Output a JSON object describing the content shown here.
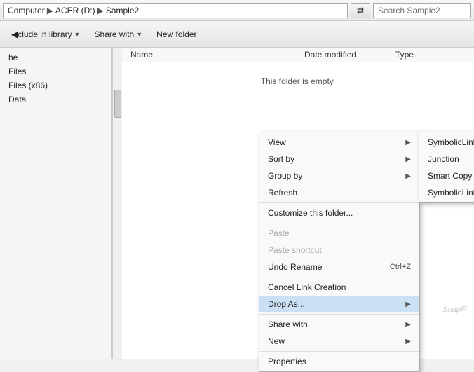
{
  "addressBar": {
    "path": [
      "Computer",
      "ACER (D:)",
      "Sample2"
    ],
    "navButtonLabel": "⇄",
    "searchPlaceholder": "Search Sample2"
  },
  "toolbar": {
    "buttons": [
      {
        "label": "clude in library",
        "arrow": "▼",
        "name": "include-in-library-btn"
      },
      {
        "label": "Share with",
        "arrow": "▼",
        "name": "share-with-btn"
      },
      {
        "label": "New folder",
        "name": "new-folder-btn"
      }
    ]
  },
  "sidebar": {
    "items": [
      {
        "label": "he",
        "name": "sidebar-item-he"
      },
      {
        "label": "Files",
        "name": "sidebar-item-files"
      },
      {
        "label": "Files (x86)",
        "name": "sidebar-item-files-x86"
      },
      {
        "label": "Data",
        "name": "sidebar-item-data"
      }
    ]
  },
  "columns": {
    "name": "Name",
    "dateModified": "Date modified",
    "type": "Type"
  },
  "emptyMessage": "This folder is empty.",
  "contextMenu": {
    "items": [
      {
        "label": "View",
        "hasArrow": true,
        "disabled": false,
        "name": "ctx-view"
      },
      {
        "label": "Sort by",
        "hasArrow": true,
        "disabled": false,
        "name": "ctx-sort-by"
      },
      {
        "label": "Group by",
        "hasArrow": true,
        "disabled": false,
        "name": "ctx-group-by"
      },
      {
        "label": "Refresh",
        "hasArrow": false,
        "disabled": false,
        "name": "ctx-refresh"
      },
      {
        "sep": true
      },
      {
        "label": "Customize this folder...",
        "hasArrow": false,
        "disabled": false,
        "name": "ctx-customize"
      },
      {
        "sep": true
      },
      {
        "label": "Paste",
        "hasArrow": false,
        "disabled": true,
        "name": "ctx-paste"
      },
      {
        "label": "Paste shortcut",
        "hasArrow": false,
        "disabled": true,
        "name": "ctx-paste-shortcut"
      },
      {
        "label": "Undo Rename",
        "shortcut": "Ctrl+Z",
        "hasArrow": false,
        "disabled": false,
        "name": "ctx-undo-rename"
      },
      {
        "sep": true
      },
      {
        "label": "Cancel Link Creation",
        "hasArrow": false,
        "disabled": false,
        "name": "ctx-cancel-link"
      },
      {
        "label": "Drop As...",
        "hasArrow": true,
        "disabled": false,
        "active": true,
        "name": "ctx-drop-as"
      },
      {
        "sep": true
      },
      {
        "label": "Share with",
        "hasArrow": true,
        "disabled": false,
        "name": "ctx-share-with"
      },
      {
        "sep": false
      },
      {
        "label": "New",
        "hasArrow": true,
        "disabled": false,
        "name": "ctx-new"
      },
      {
        "sep": true
      },
      {
        "label": "Properties",
        "hasArrow": false,
        "disabled": false,
        "name": "ctx-properties"
      }
    ]
  },
  "submenuDropAs": {
    "items": [
      {
        "label": "SymbolicLink",
        "name": "submenu-symbolic-link"
      },
      {
        "label": "Junction",
        "name": "submenu-junction"
      },
      {
        "label": "Smart Copy",
        "name": "submenu-smart-copy"
      },
      {
        "label": "SymbolicLink Clone",
        "name": "submenu-symbolic-link-clone"
      }
    ]
  },
  "watermark": "SnapFi"
}
